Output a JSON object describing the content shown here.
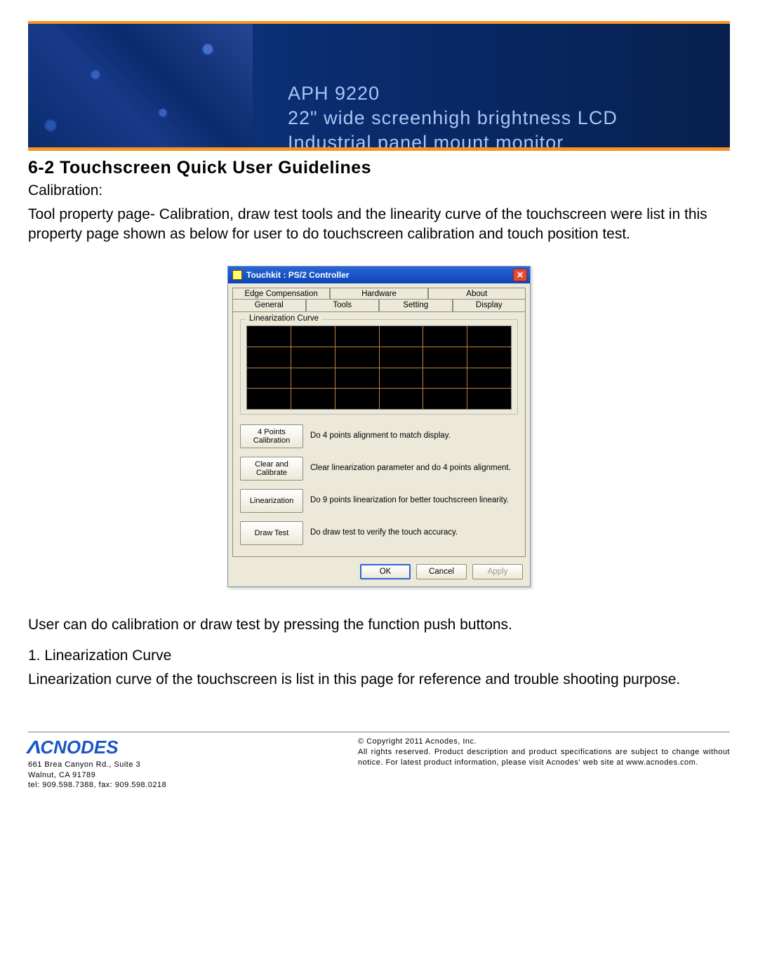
{
  "banner": {
    "line1": "APH 9220",
    "line2": "22\" wide screenhigh brightness LCD",
    "line3": "Industrial panel mount monitor"
  },
  "section": {
    "heading": "6-2  Touchscreen Quick User Guidelines",
    "calibration_label": "Calibration:",
    "intro": "Tool property page- Calibration, draw test tools and the linearity curve of the touchscreen were list in this property page shown as below for user to do touchscreen calibration and touch position test."
  },
  "dialog": {
    "title": "Touchkit : PS/2 Controller",
    "tabs_back": [
      "Edge Compensation",
      "Hardware",
      "About"
    ],
    "tabs_front": [
      "General",
      "Tools",
      "Setting",
      "Display"
    ],
    "active_tab": "Tools",
    "group_label": "Linearization Curve",
    "actions": [
      {
        "button": "4 Points Calibration",
        "desc": "Do 4 points alignment to match display."
      },
      {
        "button": "Clear and Calibrate",
        "desc": "Clear linearization parameter and do 4 points alignment."
      },
      {
        "button": "Linearization",
        "desc": "Do 9 points linearization for better touchscreen linearity."
      },
      {
        "button": "Draw Test",
        "desc": "Do draw test to verify the touch accuracy."
      }
    ],
    "buttons": {
      "ok": "OK",
      "cancel": "Cancel",
      "apply": "Apply"
    }
  },
  "after": {
    "p1": "User can do calibration or draw test by pressing the function push buttons.",
    "p2_label": "1. Linearization Curve",
    "p3": "Linearization curve of the touchscreen is list in this page for reference and trouble shooting purpose."
  },
  "footer": {
    "logo": "CNODES",
    "addr1": "661 Brea Canyon Rd., Suite 3",
    "addr2": "Walnut, CA 91789",
    "addr3": "tel: 909.598.7388, fax: 909.598.0218",
    "copy1": "© Copyright 2011 Acnodes, Inc.",
    "copy2": "All rights reserved. Product description and product specifications are subject to change without notice. For latest product information, please visit Acnodes' web site at www.acnodes.com."
  }
}
